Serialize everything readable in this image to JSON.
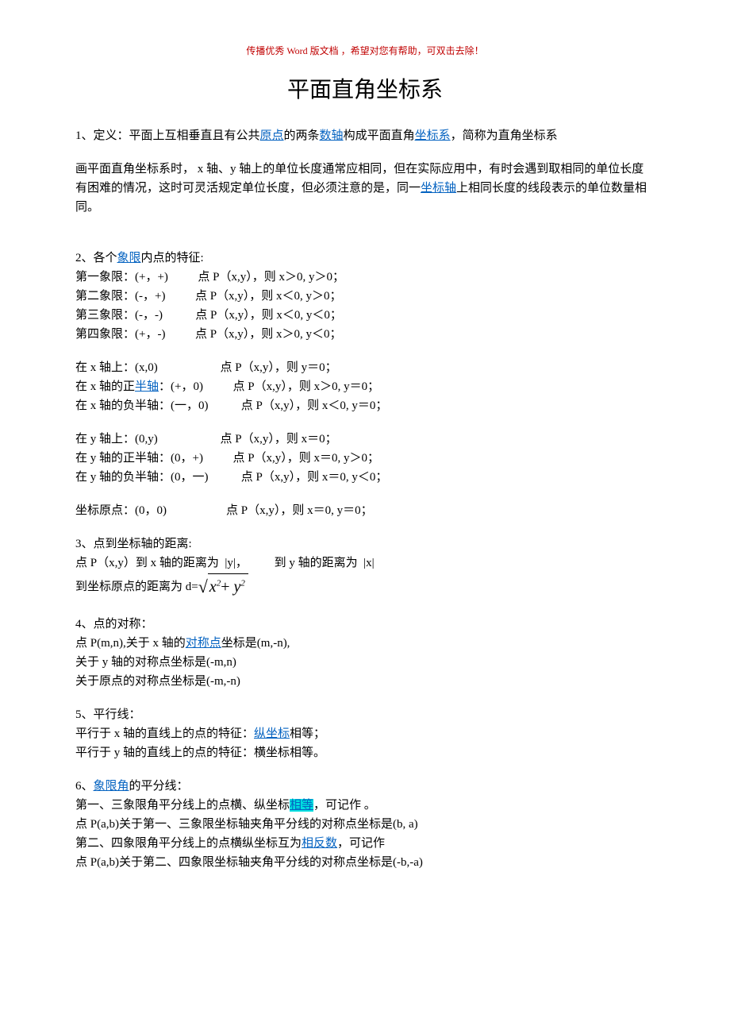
{
  "header_note": "传播优秀 Word 版文档 ，希望对您有帮助，可双击去除！",
  "title": "平面直角坐标系",
  "s1": {
    "part1": "1、定义：平面上互相垂直且有公共",
    "link1": "原点",
    "part2": "的两条",
    "link2": "数轴",
    "part3": "构成平面直角",
    "link3": "坐标系",
    "part4": "，简称为直角坐标系"
  },
  "p1": {
    "part1": "画平面直角坐标系时，  x 轴、y 轴上的单位长度通常应相同，但在实际应用中，有时会遇到取相同的单位长度有困难的情况，这时可灵活规定单位长度，但必须注意的是，同一",
    "link1": "坐标轴",
    "part2": "上相同长度的线段表示的单位数量相同。"
  },
  "s2": {
    "head_a": "2、各个",
    "head_link": "象限",
    "head_b": "内点的特征:",
    "q1": "第一象限：(+，+)          点 P（x,y），则 x＞0, y＞0；",
    "q2": "第二象限：(-，+)          点 P（x,y），则 x＜0, y＞0；",
    "q3": "第三象限：(-，-)           点 P（x,y），则 x＜0, y＜0；",
    "q4": "第四象限：(+，-)          点 P（x,y），则 x＞0, y＜0；",
    "x_on": "在 x 轴上：(x,0)                     点 P（x,y），则 y＝0；",
    "x_pos_a": "在 x 轴的正",
    "x_pos_link": "半轴",
    "x_pos_b": "：(+，0)          点 P（x,y），则 x＞0, y＝0；",
    "x_neg": "在 x 轴的负半轴：(一，0)           点 P（x,y），则 x＜0, y＝0；",
    "y_on": "在 y 轴上：(0,y)                     点 P（x,y），则 x＝0；",
    "y_pos": "在 y 轴的正半轴：(0，+)          点 P（x,y），则 x＝0, y＞0；",
    "y_neg": "在 y 轴的负半轴：(0，一)           点 P（x,y），则 x＝0, y＜0；",
    "origin": "坐标原点：(0，0)                    点 P（x,y），则 x＝0, y＝0；"
  },
  "s3": {
    "head": "3、点到坐标轴的距离:",
    "l1": "点 P（x,y）到 x 轴的距离为  |y|，         到 y 轴的距离为  |x|",
    "l2a": "到坐标原点的距离为 d=",
    "fx": "x",
    "plus": "+",
    "fy": "y",
    "exp": "2"
  },
  "s4": {
    "head": "4、点的对称：",
    "l1a": "点 P(m,n),关于 x 轴的",
    "l1link": "对称点",
    "l1b": "坐标是(m,-n),",
    "l2": "关于 y 轴的对称点坐标是(-m,n)",
    "l3": "关于原点的对称点坐标是(-m,-n)"
  },
  "s5": {
    "head": "5、平行线：",
    "l1a": "平行于 x 轴的直线上的点的特征：",
    "l1link": "纵坐标",
    "l1b": "相等；",
    "l2": "平行于 y 轴的直线上的点的特征：横坐标相等。"
  },
  "s6": {
    "head_a": "6、",
    "head_link": "象限角",
    "head_b": "的平分线：",
    "l1a": "第一、三象限角平分线上的点横、纵坐标",
    "l1hl": "相等",
    "l1b": "，可记作 。",
    "l2": "点 P(a,b)关于第一、三象限坐标轴夹角平分线的对称点坐标是(b, a)",
    "l3a": "第二、四象限角平分线上的点横纵坐标互为",
    "l3link": "相反数",
    "l3b": "，可记作",
    "l4": "点 P(a,b)关于第二、四象限坐标轴夹角平分线的对称点坐标是(-b,-a)"
  }
}
